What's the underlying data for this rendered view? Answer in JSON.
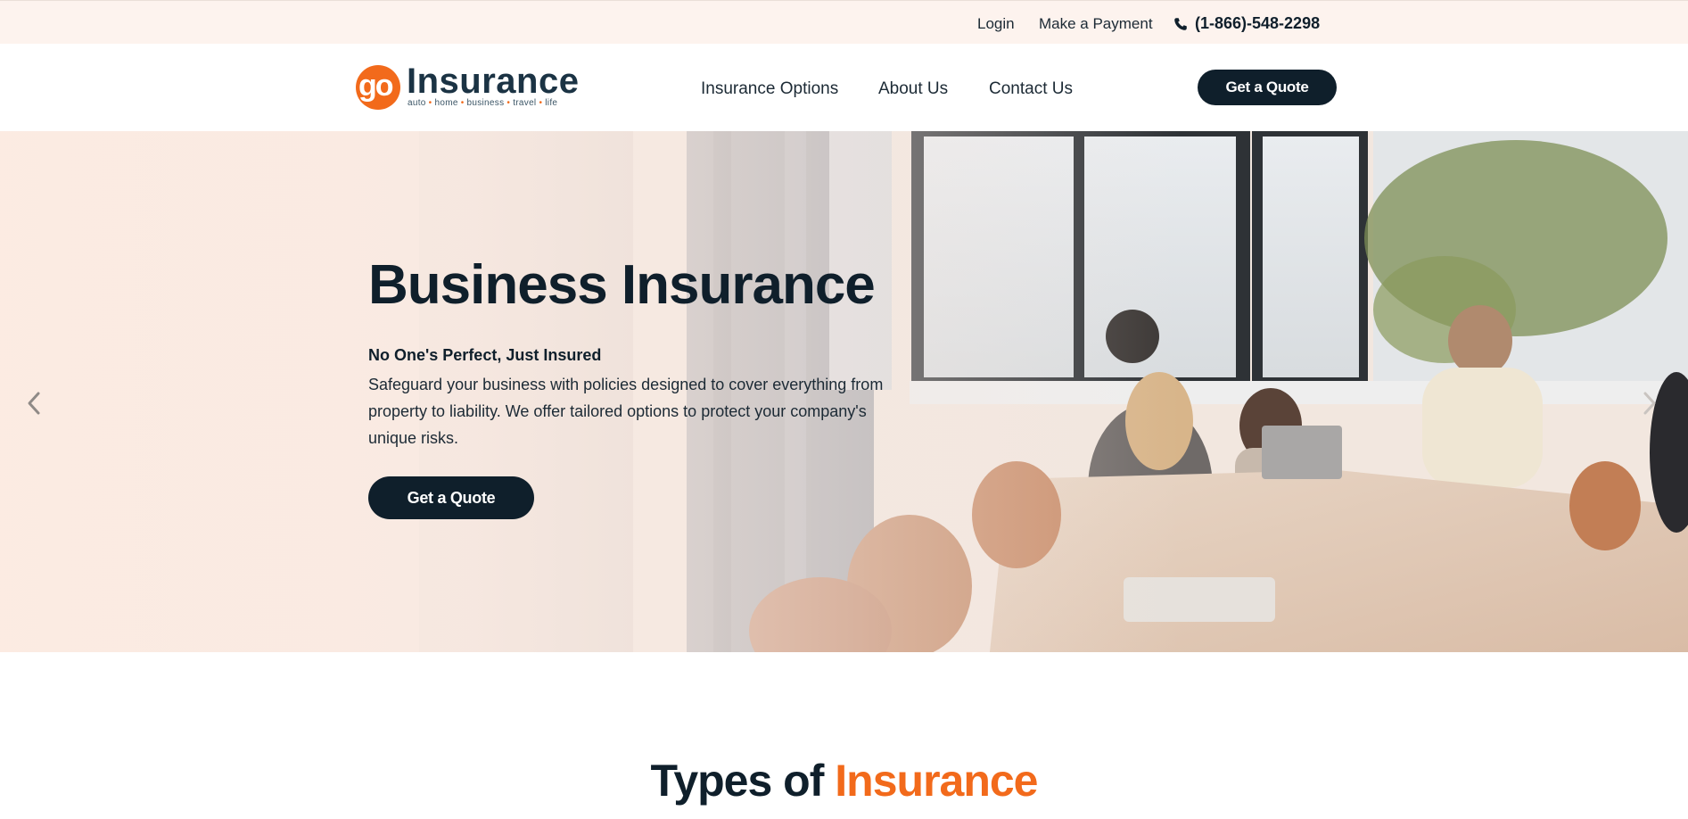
{
  "topbar": {
    "login": "Login",
    "payment": "Make a Payment",
    "phone": "(1-866)-548-2298",
    "phone_icon": "phone-icon"
  },
  "header": {
    "logo": {
      "mark": "go",
      "word": "Insurance",
      "tagline": [
        "auto",
        "home",
        "business",
        "travel",
        "life"
      ]
    },
    "nav": [
      "Insurance Options",
      "About Us",
      "Contact Us"
    ],
    "cta": "Get a Quote"
  },
  "hero": {
    "title": "Business Insurance",
    "subtitle": "No One's Perfect, Just Insured",
    "body": "Safeguard your business with policies designed to cover everything from property to liability. We offer tailored options to protect your company's unique risks.",
    "cta": "Get a Quote",
    "prev_icon": "chevron-left-icon",
    "next_icon": "chevron-right-icon"
  },
  "types": {
    "heading_part1": "Types of",
    "heading_part2": "Insurance"
  },
  "colors": {
    "brand_orange": "#f26a1b",
    "navy": "#0f1f2b",
    "topbar_bg": "#fdf3ee"
  }
}
